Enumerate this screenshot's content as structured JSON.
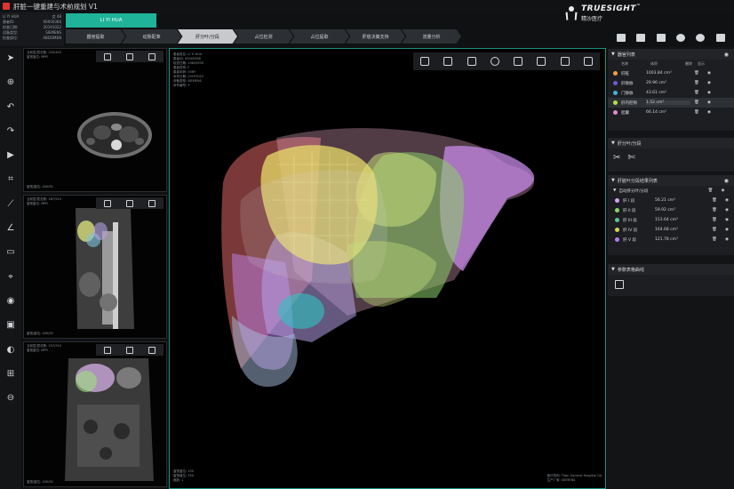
{
  "app": {
    "title": "肝脏一键重建与术前规划 V1",
    "patient_tab": "LI YI HUA"
  },
  "patient_info": [
    [
      "LI YI HUA",
      "女 48"
    ],
    [
      "患者ID:",
      "00000366"
    ],
    [
      "检查日期:",
      "20191022"
    ],
    [
      "设备类型:",
      "SIEMENS"
    ],
    [
      "检查部位:",
      "ABDOMEN"
    ]
  ],
  "brand": {
    "name": "TRUESIGHT",
    "tm": "™",
    "sub": "精沙医疗"
  },
  "workflow": [
    "器官提取",
    "动脉配准",
    "肝分叶/分段",
    "占位检测",
    "占位提取",
    "肝癌决策支持",
    "流量分析"
  ],
  "workflow_active": 2,
  "viewports": [
    {
      "info": [
        "当前层/层总数: 220/403",
        "窗宽窗位: MPR"
      ],
      "foot": "窗宽/窗位: 400/50"
    },
    {
      "info": [
        "当前层/层总数: 267/510",
        "窗宽窗位: MPR"
      ],
      "foot": "窗宽/窗位: 400/50"
    },
    {
      "info": [
        "当前层/层总数: 257/510",
        "窗宽窗位: MPR"
      ],
      "foot": "窗宽/窗位: 400/50"
    }
  ],
  "main_view": {
    "info": [
      "患者姓名: LI YI HUA",
      "患者ID: 00000366",
      "检查日期: 19620930",
      "患者性别: F",
      "患者年龄: 056Y",
      "序列日期: 20191022",
      "设备类型: SIEMENS",
      "序列编号: 3"
    ],
    "foot_left": [
      "窗宽窗位: 190",
      "窗宽窗位: 350",
      "缩放: 1"
    ],
    "foot_right": [
      "医疗机构: Tiatn General Hospital Qd",
      "生产厂家: SIEMENS"
    ]
  },
  "organ_panel": {
    "title": "器官列表",
    "headers": [
      "名称",
      "体积",
      "删除",
      "显示"
    ],
    "rows": [
      {
        "name": "肝脏",
        "volume": "1003.84 cm³",
        "color": "#f0a040"
      },
      {
        "name": "肝静脉",
        "volume": "29.96 cm³",
        "color": "#6b5bd6"
      },
      {
        "name": "门静脉",
        "volume": "43.61 cm³",
        "color": "#3fb4d8"
      },
      {
        "name": "肝内腔隙",
        "volume": "1.52 cm³",
        "color": "#b7e04a"
      },
      {
        "name": "胆囊",
        "volume": "66.14 cm³",
        "color": "#e58ad0"
      }
    ]
  },
  "segment_tool": {
    "title": "肝分叶/分段"
  },
  "segment_panel": {
    "title": "肝脏叶分段结果列表",
    "group": "自动肝分叶/分段",
    "rows": [
      {
        "name": "肝 I 段",
        "volume": "56.21 cm³",
        "color": "#d9a3f0"
      },
      {
        "name": "肝 II 段",
        "volume": "59.92 cm³",
        "color": "#8fd46a"
      },
      {
        "name": "肝 III 段",
        "volume": "153.64 cm³",
        "color": "#60c48c"
      },
      {
        "name": "肝 IV 段",
        "volume": "164.68 cm³",
        "color": "#d8d35a"
      },
      {
        "name": "肝 V 段",
        "volume": "121.78 cm³",
        "color": "#b57cf0"
      }
    ]
  },
  "curve_panel": {
    "title": "参数表格曲线"
  }
}
